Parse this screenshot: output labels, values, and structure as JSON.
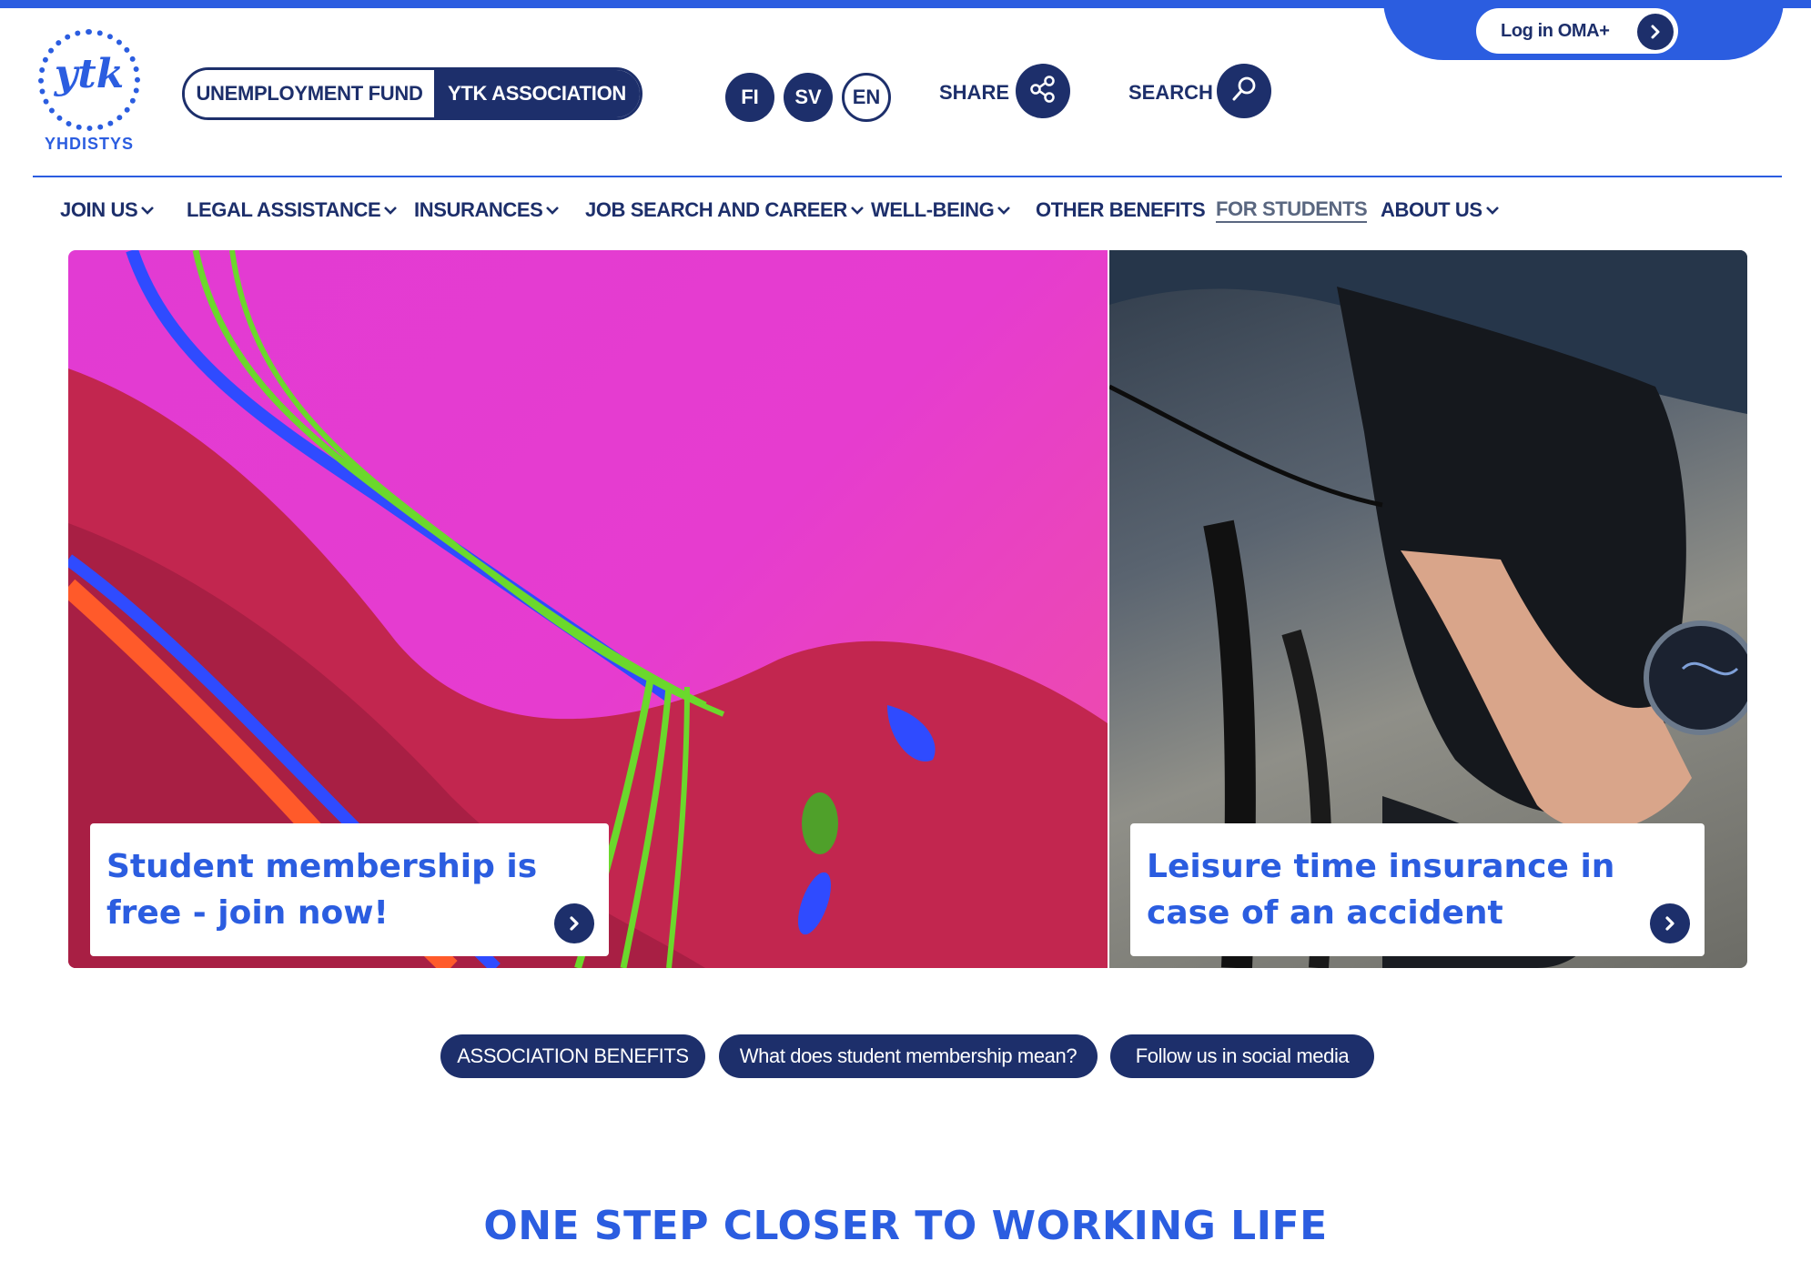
{
  "header": {
    "login_label": "Log in OMA+",
    "logo_mark": "ytk",
    "logo_word": "YHDISTYS",
    "switch": {
      "left_label": "UNEMPLOYMENT FUND",
      "right_label": "YTK ASSOCIATION",
      "selected": "YTK ASSOCIATION"
    },
    "languages": [
      "FI",
      "SV",
      "EN"
    ],
    "share_label": "SHARE",
    "search_label": "SEARCH"
  },
  "nav": {
    "items": [
      {
        "label": "JOIN US",
        "dropdown": true
      },
      {
        "label": "LEGAL ASSISTANCE",
        "dropdown": true
      },
      {
        "label": "INSURANCES",
        "dropdown": true
      },
      {
        "label": "JOB SEARCH AND CAREER",
        "dropdown": true
      },
      {
        "label": "WELL-BEING",
        "dropdown": true
      },
      {
        "label": "OTHER BENEFITS",
        "dropdown": false
      },
      {
        "label": "FOR STUDENTS",
        "dropdown": false,
        "active": true
      },
      {
        "label": "ABOUT US",
        "dropdown": true
      }
    ]
  },
  "hero": {
    "left": {
      "caption": "Student membership is free - join now!"
    },
    "right": {
      "caption": "Leisure time insurance in case of an accident"
    }
  },
  "quick_links": [
    "ASSOCIATION BENEFITS",
    "What does student membership mean?",
    "Follow us in social media"
  ],
  "headline": "ONE STEP CLOSER TO WORKING LIFE",
  "colors": {
    "brand_blue": "#2b5de0",
    "navy": "#1d2f6b",
    "white": "#ffffff"
  },
  "icons": [
    "chevron-right-icon",
    "share-icon",
    "search-icon",
    "chevron-down-icon"
  ]
}
